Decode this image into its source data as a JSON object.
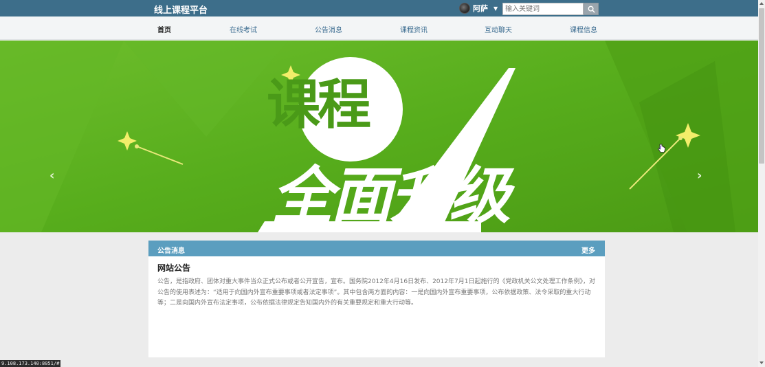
{
  "header": {
    "brand": "线上课程平台",
    "user_name": "阿萨",
    "search_placeholder": "输入关键词"
  },
  "nav": {
    "items": [
      {
        "label": "首页",
        "active": true
      },
      {
        "label": "在线考试"
      },
      {
        "label": "公告消息"
      },
      {
        "label": "课程资讯"
      },
      {
        "label": "互动聊天"
      },
      {
        "label": "课程信息"
      }
    ]
  },
  "banner": {
    "line1": "课程",
    "line2": "全面升级",
    "prev_arrow": "‹",
    "next_arrow": "›"
  },
  "notice_panel": {
    "header_title": "公告消息",
    "more_label": "更多",
    "title": "网站公告",
    "body": "公告，是指政府、团体对重大事件当众正式公布或者公开宣告，宣布。国务院2012年4月16日发布、2012年7月1日起施行的《党政机关公文处理工作条例》，对公告的使用表述为：“适用于向国内外宣布重要事项或者法定事项”。其中包含两方面的内容：一是向国内外宣布重要事项，公布依据政策、法令采取的重大行动等；二是向国内外宣布法定事项，公布依据法律规定告知国内外的有关重要规定和重大行动等。"
  },
  "status_bar": {
    "url": "9.108.173.140:8051/#"
  },
  "colors": {
    "topbar": "#3d6e8a",
    "banner_green": "#5aae1e",
    "panel_header": "#5b9ebf",
    "nav_link": "#3b6c90"
  }
}
